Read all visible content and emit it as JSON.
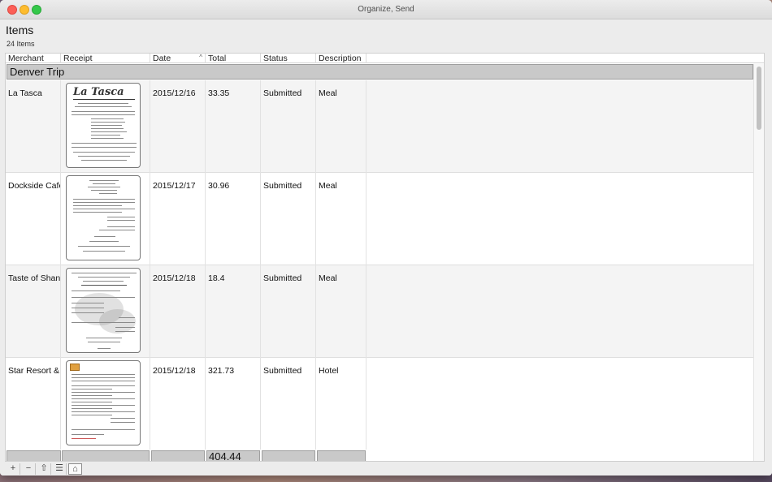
{
  "window": {
    "title": "Organize, Send"
  },
  "header": {
    "title": "Items",
    "count": "24 Items"
  },
  "columns": [
    "Merchant",
    "Receipt",
    "Date",
    "Total",
    "Status",
    "Description"
  ],
  "sort": {
    "column": "Date",
    "indicator": "^"
  },
  "group": {
    "name": "Denver Trip"
  },
  "rows": [
    {
      "merchant": "La Tasca",
      "receipt_title": "La Tasca",
      "date": "2015/12/16",
      "total": "33.35",
      "status": "Submitted",
      "description": "Meal"
    },
    {
      "merchant": "Dockside Cafe",
      "receipt_title": "",
      "date": "2015/12/17",
      "total": "30.96",
      "status": "Submitted",
      "description": "Meal"
    },
    {
      "merchant": "Taste of Shang",
      "receipt_title": "",
      "date": "2015/12/18",
      "total": "18.4",
      "status": "Submitted",
      "description": "Meal"
    },
    {
      "merchant": "Star Resort &",
      "receipt_title": "",
      "date": "2015/12/18",
      "total": "321.73",
      "status": "Submitted",
      "description": "Hotel"
    }
  ],
  "footer": {
    "total": "404.44"
  },
  "toolbar": {
    "add": "+",
    "remove": "−",
    "share": "⇧",
    "list": "☰",
    "home": "⌂"
  },
  "colors": {
    "group_bg": "#c9c9c9",
    "alt_row": "#f4f4f4",
    "close": "#fc5f57",
    "minimize": "#fdbc2e",
    "zoom": "#34c84a"
  }
}
